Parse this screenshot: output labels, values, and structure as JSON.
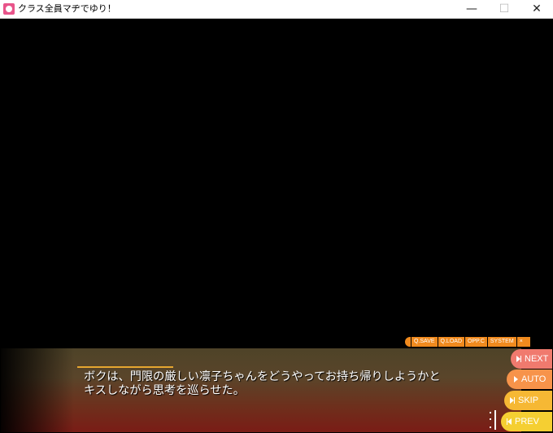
{
  "window": {
    "title": "クラス全員マヂでゆり！",
    "minimize_glyph": "—",
    "maximize_glyph": "☐",
    "close_glyph": "✕"
  },
  "quick_menu": {
    "items": [
      {
        "label": "Q.SAVE"
      },
      {
        "label": "Q.LOAD"
      },
      {
        "label": "OPP.C"
      },
      {
        "label": "SYSTEM"
      },
      {
        "label": "×"
      }
    ]
  },
  "message": {
    "text": "ボクは、門限の厳しい凛子ちゃんをどうやってお持ち帰りしようかと\nキスしながら思考を巡らせた。"
  },
  "side_buttons": {
    "next": "NEXT",
    "auto": "AUTO",
    "skip": "SKIP",
    "prev": "PREV"
  },
  "colors": {
    "next": "#f07a6e",
    "auto": "#f7934a",
    "skip": "#f6b834",
    "prev": "#f5cf32",
    "quick_menu": "#f08a1e",
    "name_line": "#e6a630"
  },
  "icons": [
    "app-icon",
    "next-icon",
    "auto-icon",
    "skip-icon",
    "prev-icon",
    "click-wait-icon"
  ]
}
